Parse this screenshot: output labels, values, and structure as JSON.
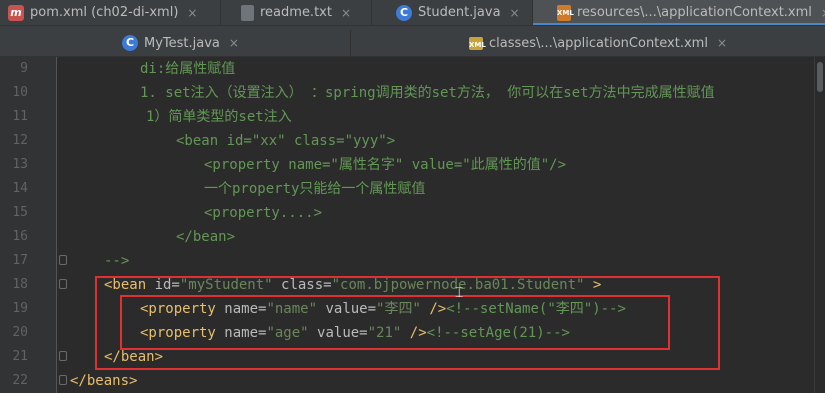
{
  "tabs_row1": [
    {
      "label": "pom.xml (ch02-di-xml)",
      "icon": "m-icon",
      "active": false
    },
    {
      "label": "readme.txt",
      "icon": "text-file-icon",
      "active": false
    },
    {
      "label": "Student.java",
      "icon": "class-icon",
      "active": false
    },
    {
      "label": "resources\\...\\applicationContext.xml",
      "icon": "xml-file-icon",
      "active": true
    }
  ],
  "tabs_row2": [
    {
      "label": "MyTest.java",
      "icon": "class-icon",
      "active": false
    },
    {
      "label": "classes\\...\\applicationContext.xml",
      "icon": "xml-file-icon",
      "active": false
    }
  ],
  "close_glyph": "×",
  "gutter": {
    "lines": [
      {
        "num": "9"
      },
      {
        "num": "10"
      },
      {
        "num": "11"
      },
      {
        "num": "12"
      },
      {
        "num": "13"
      },
      {
        "num": "14"
      },
      {
        "num": "15"
      },
      {
        "num": "16"
      },
      {
        "num": "17"
      },
      {
        "num": "18"
      },
      {
        "num": "19"
      },
      {
        "num": "20"
      },
      {
        "num": "21"
      },
      {
        "num": "22"
      }
    ]
  },
  "code": {
    "l9": "di:给属性赋值",
    "l10": "1. set注入（设置注入） ：spring调用类的set方法， 你可以在set方法中完成属性赋值",
    "l11": "1）简单类型的set注入",
    "l12": "<bean id=\"xx\" class=\"yyy\">",
    "l13": "<property name=\"属性名字\" value=\"此属性的值\"/>",
    "l14": "一个property只能给一个属性赋值",
    "l15": "<property....>",
    "l16": "</bean>",
    "l17": "-->",
    "l18": {
      "open": "<bean ",
      "a1": "id=",
      "v1": "\"myStudent\"",
      "a2": " class=",
      "v2": "\"com.bjpowernode.ba01.Student\"",
      "close": " >"
    },
    "l19": {
      "open": "<property ",
      "a1": "name=",
      "v1": "\"name\"",
      "a2": " value=",
      "v2": "\"李四\"",
      "close": " />",
      "cmt": "<!--setName(\"李四\")-->"
    },
    "l20": {
      "open": "<property ",
      "a1": "name=",
      "v1": "\"age\"",
      "a2": " value=",
      "v2": "\"21\"",
      "close": " />",
      "cmt": "<!--setAge(21)-->"
    },
    "l21": "</bean>",
    "l22": "</beans>"
  }
}
